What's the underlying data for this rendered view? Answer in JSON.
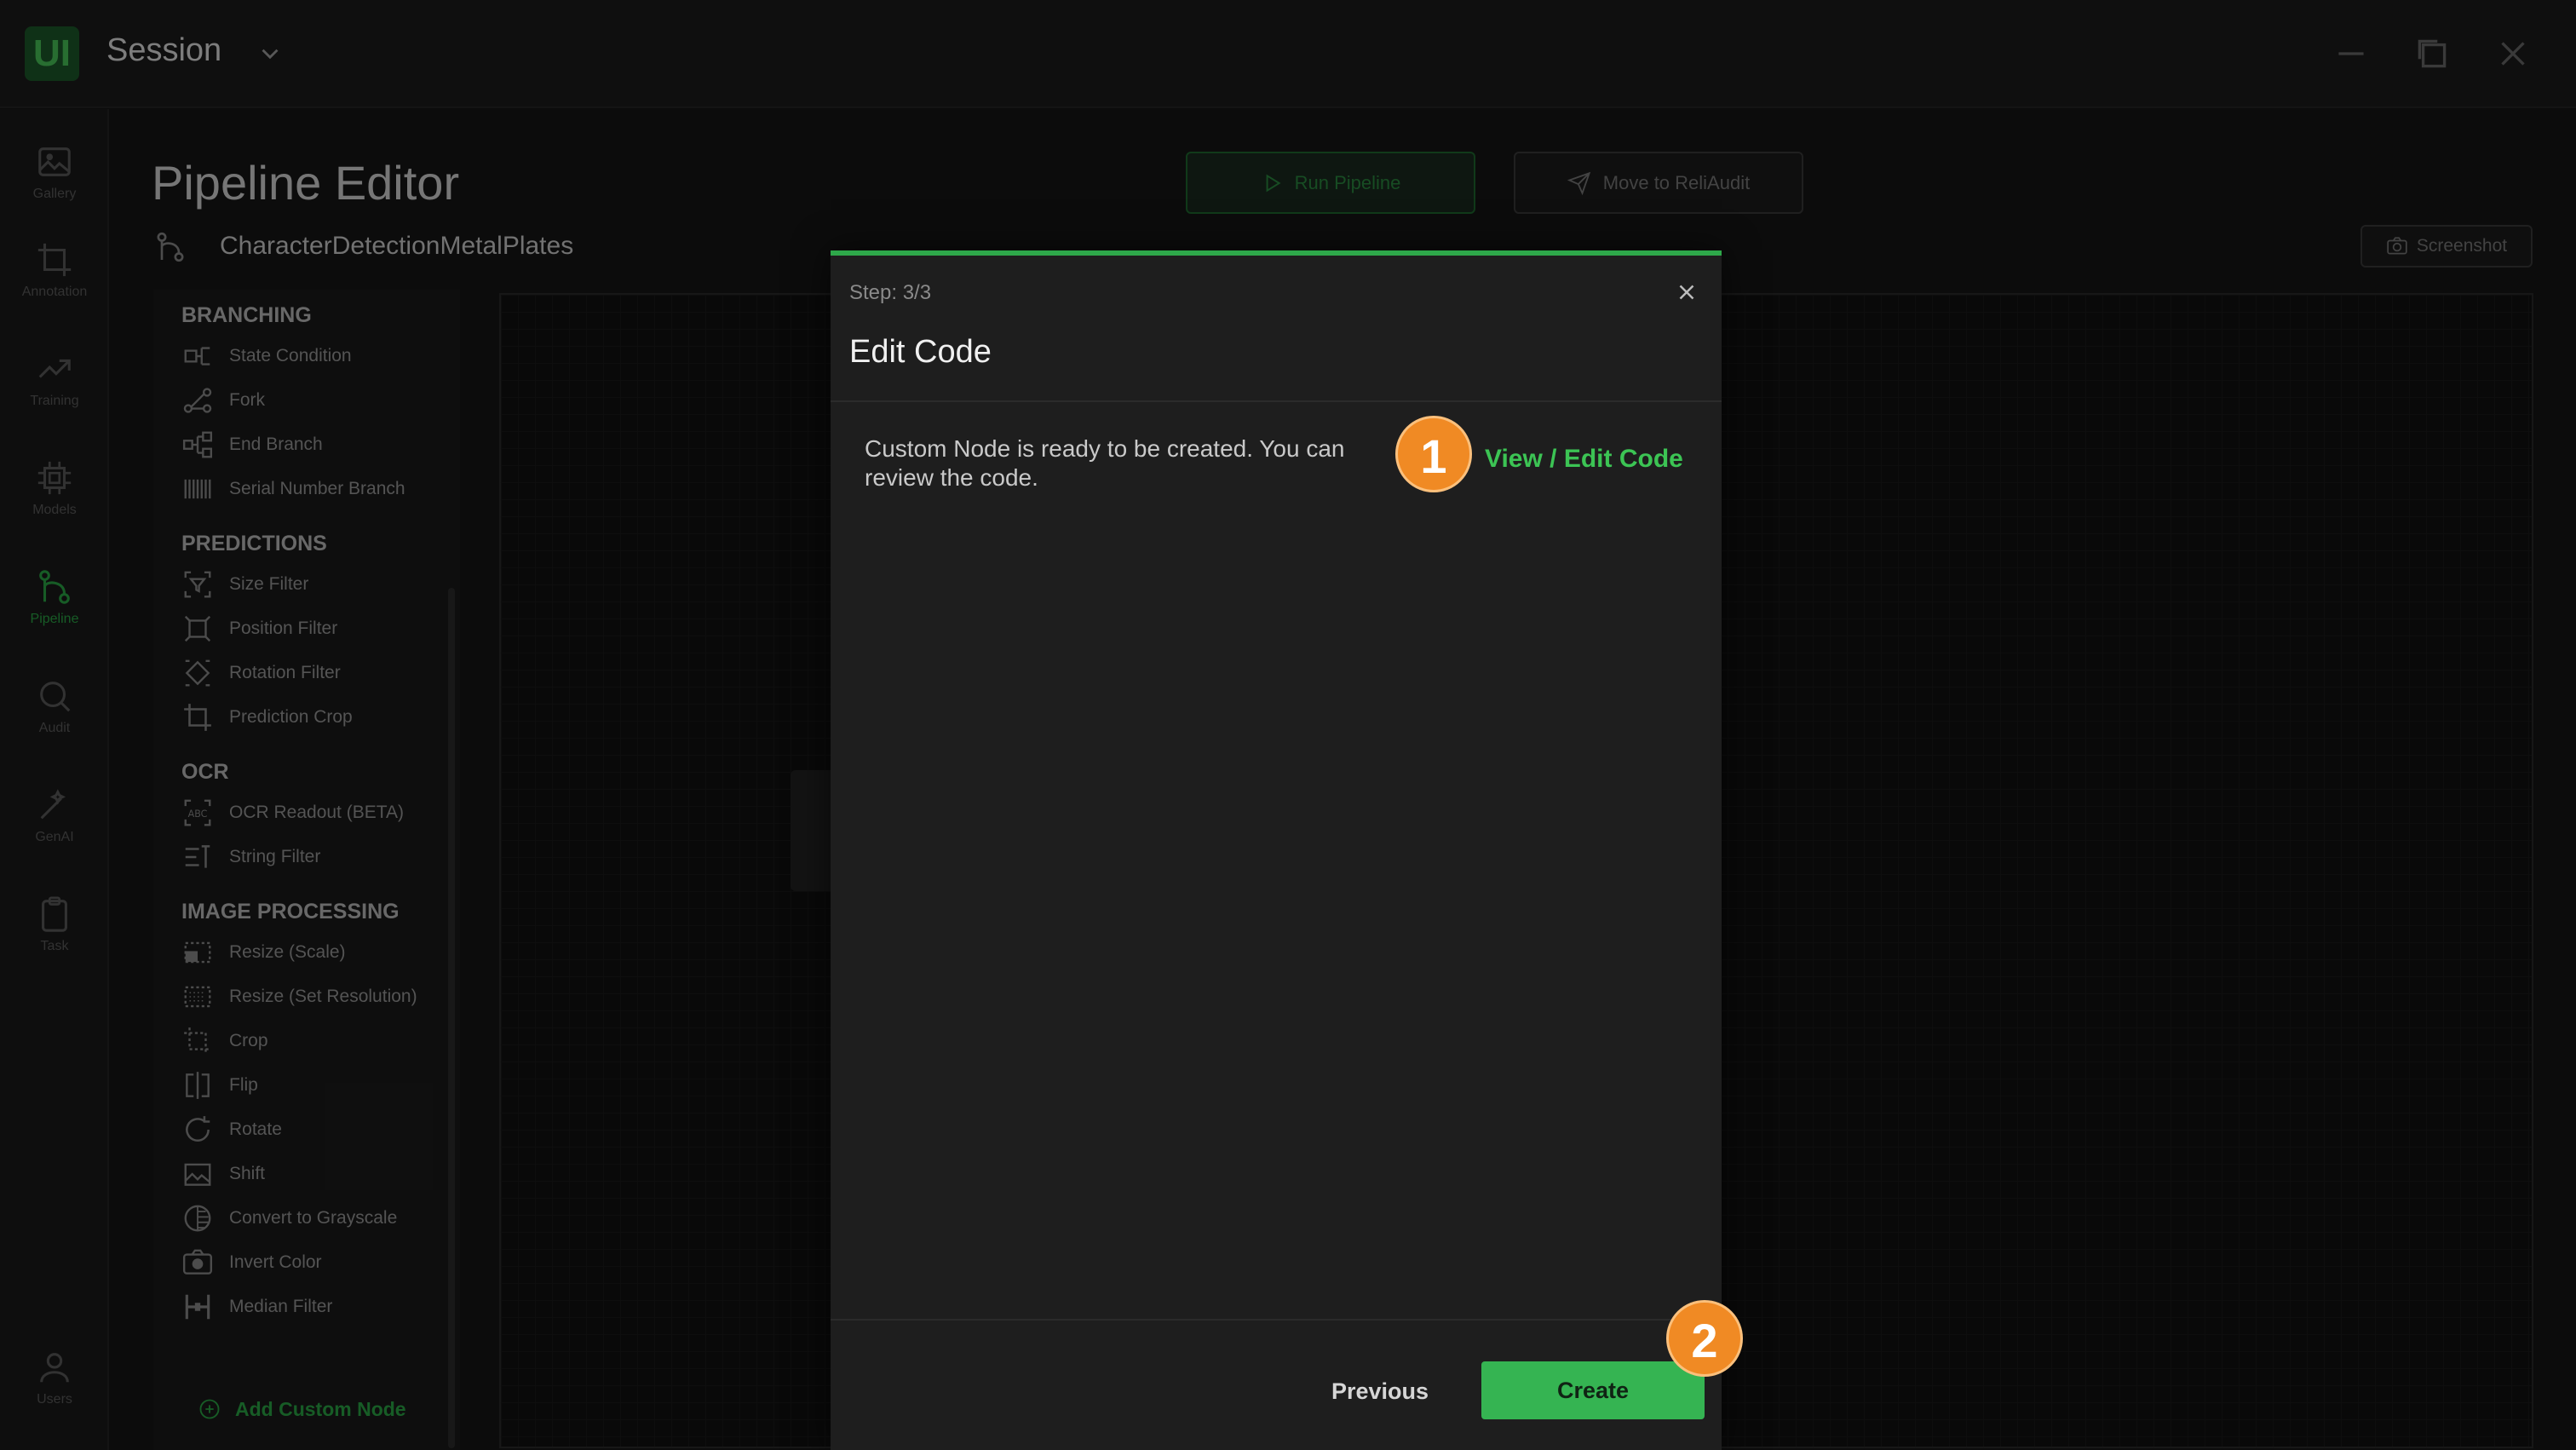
{
  "app": {
    "logo_text": "UI",
    "session_title": "Session"
  },
  "rail": {
    "items": [
      {
        "label": "Gallery",
        "icon": "image-icon"
      },
      {
        "label": "Annotation",
        "icon": "crop-icon"
      },
      {
        "label": "Training",
        "icon": "trend-icon"
      },
      {
        "label": "Models",
        "icon": "chip-icon"
      },
      {
        "label": "Pipeline",
        "icon": "pipeline-icon"
      },
      {
        "label": "Audit",
        "icon": "search-icon"
      },
      {
        "label": "GenAI",
        "icon": "magic-wand-icon"
      },
      {
        "label": "Task",
        "icon": "clipboard-icon"
      },
      {
        "label": "Users",
        "icon": "user-icon"
      }
    ]
  },
  "header": {
    "title": "Pipeline Editor",
    "pipeline_name": "CharacterDetectionMetalPlates",
    "run_label": "Run Pipeline",
    "move_label": "Move to ReliAudit",
    "screenshot_label": "Screenshot"
  },
  "library": {
    "sections": [
      {
        "title": "BRANCHING",
        "items": [
          "State Condition",
          "Fork",
          "End Branch",
          "Serial Number Branch"
        ]
      },
      {
        "title": "PREDICTIONS",
        "items": [
          "Size Filter",
          "Position Filter",
          "Rotation Filter",
          "Prediction Crop"
        ]
      },
      {
        "title": "OCR",
        "items": [
          "OCR Readout (BETA)",
          "String Filter"
        ]
      },
      {
        "title": "IMAGE PROCESSING",
        "items": [
          "Resize (Scale)",
          "Resize (Set Resolution)",
          "Crop",
          "Flip",
          "Rotate",
          "Shift",
          "Convert to Grayscale",
          "Invert Color",
          "Median Filter"
        ]
      }
    ],
    "add_custom_label": "Add Custom Node"
  },
  "modal": {
    "step": "Step: 3/3",
    "title": "Edit Code",
    "message": "Custom Node is ready to be created. You can review the code.",
    "view_edit_label": "View / Edit Code",
    "previous_label": "Previous",
    "create_label": "Create"
  },
  "badges": {
    "first": "1",
    "second": "2"
  },
  "colors": {
    "accent_green": "#35b452",
    "badge_orange": "#f08a24"
  }
}
